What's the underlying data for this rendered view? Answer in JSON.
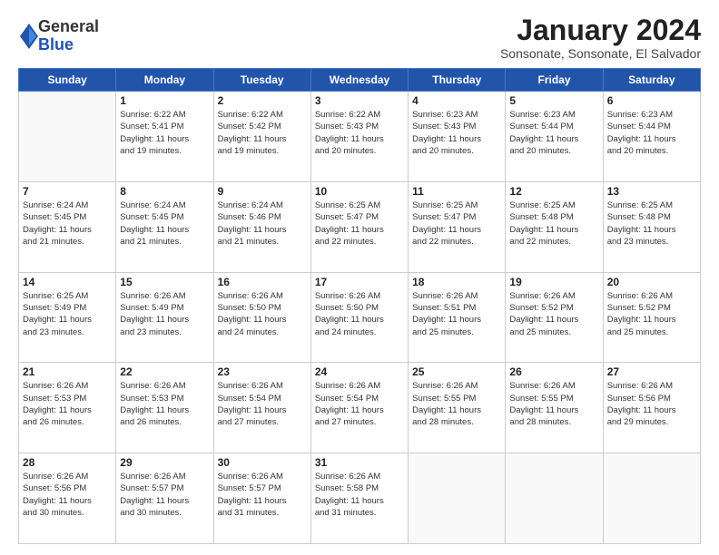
{
  "logo": {
    "general": "General",
    "blue": "Blue"
  },
  "header": {
    "title": "January 2024",
    "location": "Sonsonate, Sonsonate, El Salvador"
  },
  "days_of_week": [
    "Sunday",
    "Monday",
    "Tuesday",
    "Wednesday",
    "Thursday",
    "Friday",
    "Saturday"
  ],
  "weeks": [
    [
      {
        "day": "",
        "info": ""
      },
      {
        "day": "1",
        "info": "Sunrise: 6:22 AM\nSunset: 5:41 PM\nDaylight: 11 hours\nand 19 minutes."
      },
      {
        "day": "2",
        "info": "Sunrise: 6:22 AM\nSunset: 5:42 PM\nDaylight: 11 hours\nand 19 minutes."
      },
      {
        "day": "3",
        "info": "Sunrise: 6:22 AM\nSunset: 5:43 PM\nDaylight: 11 hours\nand 20 minutes."
      },
      {
        "day": "4",
        "info": "Sunrise: 6:23 AM\nSunset: 5:43 PM\nDaylight: 11 hours\nand 20 minutes."
      },
      {
        "day": "5",
        "info": "Sunrise: 6:23 AM\nSunset: 5:44 PM\nDaylight: 11 hours\nand 20 minutes."
      },
      {
        "day": "6",
        "info": "Sunrise: 6:23 AM\nSunset: 5:44 PM\nDaylight: 11 hours\nand 20 minutes."
      }
    ],
    [
      {
        "day": "7",
        "info": "Sunrise: 6:24 AM\nSunset: 5:45 PM\nDaylight: 11 hours\nand 21 minutes."
      },
      {
        "day": "8",
        "info": "Sunrise: 6:24 AM\nSunset: 5:45 PM\nDaylight: 11 hours\nand 21 minutes."
      },
      {
        "day": "9",
        "info": "Sunrise: 6:24 AM\nSunset: 5:46 PM\nDaylight: 11 hours\nand 21 minutes."
      },
      {
        "day": "10",
        "info": "Sunrise: 6:25 AM\nSunset: 5:47 PM\nDaylight: 11 hours\nand 22 minutes."
      },
      {
        "day": "11",
        "info": "Sunrise: 6:25 AM\nSunset: 5:47 PM\nDaylight: 11 hours\nand 22 minutes."
      },
      {
        "day": "12",
        "info": "Sunrise: 6:25 AM\nSunset: 5:48 PM\nDaylight: 11 hours\nand 22 minutes."
      },
      {
        "day": "13",
        "info": "Sunrise: 6:25 AM\nSunset: 5:48 PM\nDaylight: 11 hours\nand 23 minutes."
      }
    ],
    [
      {
        "day": "14",
        "info": "Sunrise: 6:25 AM\nSunset: 5:49 PM\nDaylight: 11 hours\nand 23 minutes."
      },
      {
        "day": "15",
        "info": "Sunrise: 6:26 AM\nSunset: 5:49 PM\nDaylight: 11 hours\nand 23 minutes."
      },
      {
        "day": "16",
        "info": "Sunrise: 6:26 AM\nSunset: 5:50 PM\nDaylight: 11 hours\nand 24 minutes."
      },
      {
        "day": "17",
        "info": "Sunrise: 6:26 AM\nSunset: 5:50 PM\nDaylight: 11 hours\nand 24 minutes."
      },
      {
        "day": "18",
        "info": "Sunrise: 6:26 AM\nSunset: 5:51 PM\nDaylight: 11 hours\nand 25 minutes."
      },
      {
        "day": "19",
        "info": "Sunrise: 6:26 AM\nSunset: 5:52 PM\nDaylight: 11 hours\nand 25 minutes."
      },
      {
        "day": "20",
        "info": "Sunrise: 6:26 AM\nSunset: 5:52 PM\nDaylight: 11 hours\nand 25 minutes."
      }
    ],
    [
      {
        "day": "21",
        "info": "Sunrise: 6:26 AM\nSunset: 5:53 PM\nDaylight: 11 hours\nand 26 minutes."
      },
      {
        "day": "22",
        "info": "Sunrise: 6:26 AM\nSunset: 5:53 PM\nDaylight: 11 hours\nand 26 minutes."
      },
      {
        "day": "23",
        "info": "Sunrise: 6:26 AM\nSunset: 5:54 PM\nDaylight: 11 hours\nand 27 minutes."
      },
      {
        "day": "24",
        "info": "Sunrise: 6:26 AM\nSunset: 5:54 PM\nDaylight: 11 hours\nand 27 minutes."
      },
      {
        "day": "25",
        "info": "Sunrise: 6:26 AM\nSunset: 5:55 PM\nDaylight: 11 hours\nand 28 minutes."
      },
      {
        "day": "26",
        "info": "Sunrise: 6:26 AM\nSunset: 5:55 PM\nDaylight: 11 hours\nand 28 minutes."
      },
      {
        "day": "27",
        "info": "Sunrise: 6:26 AM\nSunset: 5:56 PM\nDaylight: 11 hours\nand 29 minutes."
      }
    ],
    [
      {
        "day": "28",
        "info": "Sunrise: 6:26 AM\nSunset: 5:56 PM\nDaylight: 11 hours\nand 30 minutes."
      },
      {
        "day": "29",
        "info": "Sunrise: 6:26 AM\nSunset: 5:57 PM\nDaylight: 11 hours\nand 30 minutes."
      },
      {
        "day": "30",
        "info": "Sunrise: 6:26 AM\nSunset: 5:57 PM\nDaylight: 11 hours\nand 31 minutes."
      },
      {
        "day": "31",
        "info": "Sunrise: 6:26 AM\nSunset: 5:58 PM\nDaylight: 11 hours\nand 31 minutes."
      },
      {
        "day": "",
        "info": ""
      },
      {
        "day": "",
        "info": ""
      },
      {
        "day": "",
        "info": ""
      }
    ]
  ]
}
